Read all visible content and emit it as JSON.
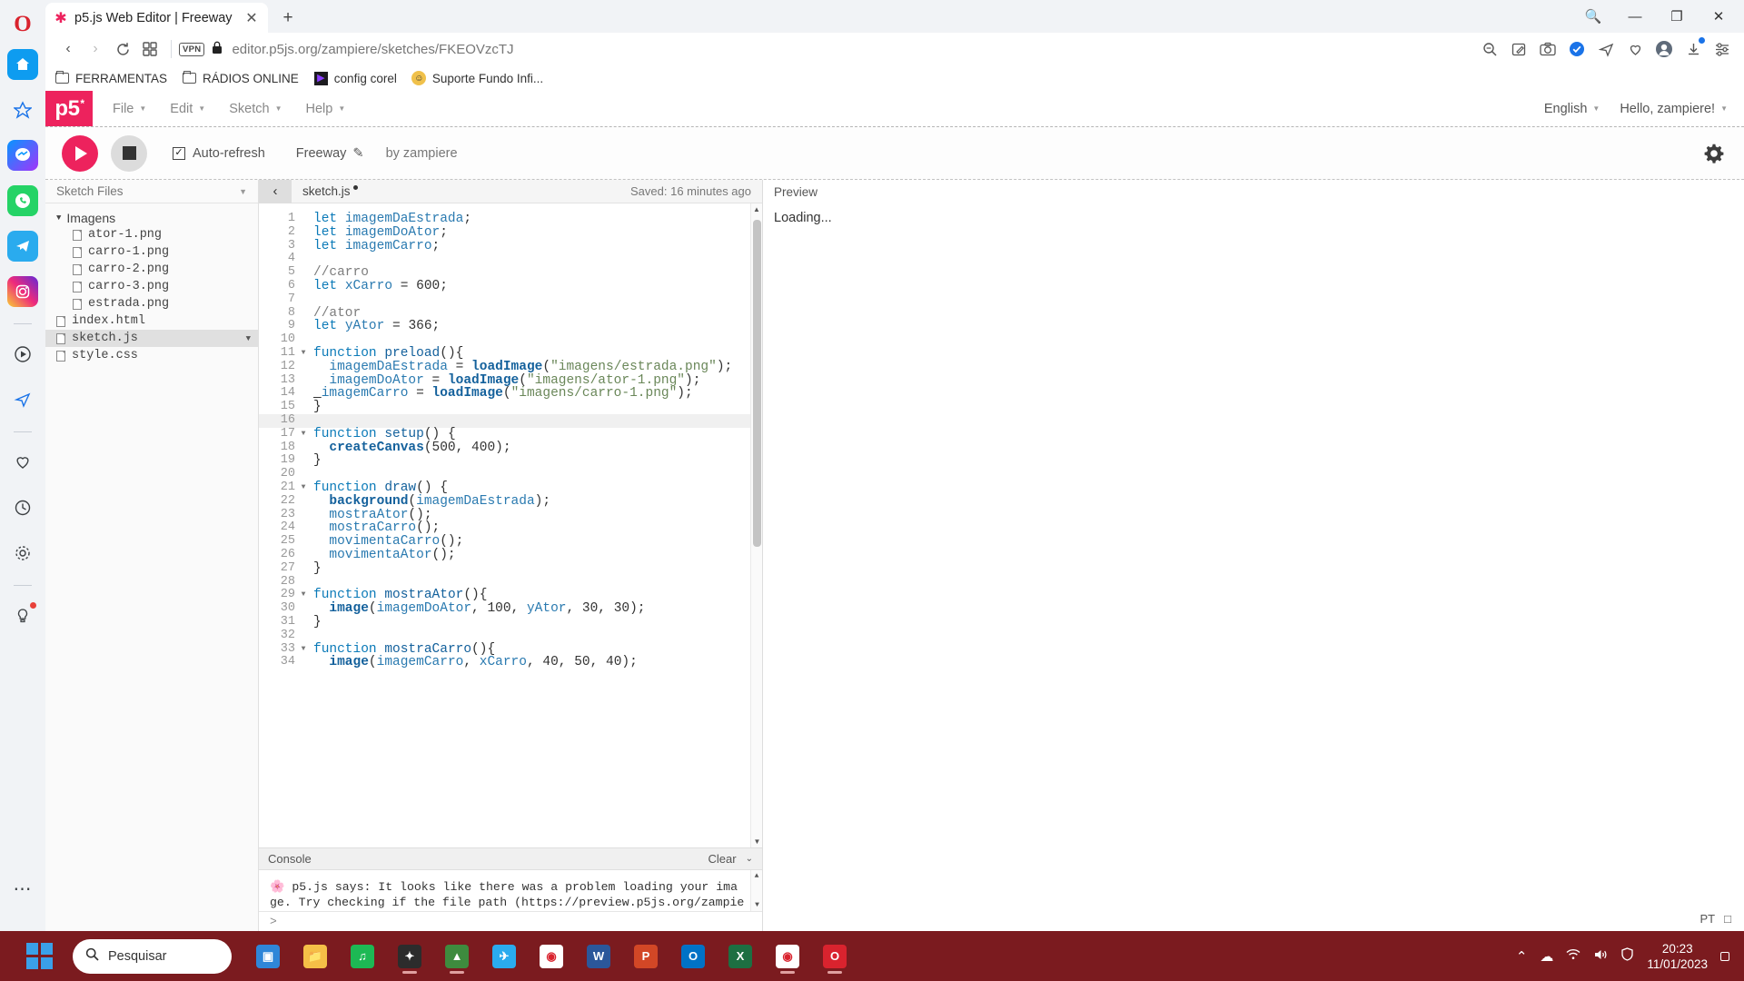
{
  "browser": {
    "name": "opera",
    "tab": {
      "title": "p5.js Web Editor | Freeway",
      "favicon": "p5-asterisk-icon",
      "close": "✕"
    },
    "newtab": "+",
    "nav": {
      "back": "‹",
      "forward": "›",
      "reload": "↻",
      "tabgrid": "∷",
      "vpn": "VPN",
      "lock": "🔒",
      "url_prefix": "editor.",
      "url_domain": "p5js.org",
      "url_path": "/zampiere/sketches/FKEOVzcTJ",
      "url_full": "editor.p5js.org/zampiere/sketches/FKEOVzcTJ"
    },
    "window_controls": {
      "minimize": "—",
      "maximize": "❐",
      "close": "✕",
      "search": "🔍"
    },
    "bookmarks": [
      {
        "label": "FERRAMENTAS",
        "icon": "folder-icon"
      },
      {
        "label": "RÁDIOS ONLINE",
        "icon": "folder-icon"
      },
      {
        "label": "config corel",
        "icon": "corel-icon"
      },
      {
        "label": "Suporte Fundo Infi...",
        "icon": "support-icon"
      }
    ]
  },
  "p5": {
    "logo": "p5",
    "logo_star": "*",
    "menu": [
      {
        "label": "File"
      },
      {
        "label": "Edit"
      },
      {
        "label": "Sketch"
      },
      {
        "label": "Help"
      }
    ],
    "language": "English",
    "account": "Hello, zampiere!",
    "toolbar": {
      "play": "play-icon",
      "stop": "stop-icon",
      "autorefresh_label": "Auto-refresh",
      "autorefresh_checked": true,
      "check_glyph": "✓",
      "sketch_name": "Freeway",
      "rename_icon": "✎",
      "byline": "by zampiere",
      "settings_icon": "⚙"
    },
    "files": {
      "panel_title": "Sketch Files",
      "tree": [
        {
          "label": "Imagens",
          "type": "folder",
          "expanded": true,
          "depth": 0
        },
        {
          "label": "ator-1.png",
          "type": "file",
          "depth": 1
        },
        {
          "label": "carro-1.png",
          "type": "file",
          "depth": 1
        },
        {
          "label": "carro-2.png",
          "type": "file",
          "depth": 1
        },
        {
          "label": "carro-3.png",
          "type": "file",
          "depth": 1
        },
        {
          "label": "estrada.png",
          "type": "file",
          "depth": 1
        },
        {
          "label": "index.html",
          "type": "file",
          "depth": 0
        },
        {
          "label": "sketch.js",
          "type": "file",
          "depth": 0,
          "selected": true
        },
        {
          "label": "style.css",
          "type": "file",
          "depth": 0
        }
      ]
    },
    "editor": {
      "collapse_icon": "‹",
      "tab_name": "sketch.js",
      "unsaved_dot": true,
      "saved_status": "Saved: 16 minutes ago",
      "code_lines": [
        {
          "n": 1,
          "segs": [
            [
              "kw",
              "let "
            ],
            [
              "var",
              "imagemDaEstrada"
            ],
            [
              "pln",
              ";"
            ]
          ]
        },
        {
          "n": 2,
          "segs": [
            [
              "kw",
              "let "
            ],
            [
              "var",
              "imagemDoAtor"
            ],
            [
              "pln",
              ";"
            ]
          ]
        },
        {
          "n": 3,
          "segs": [
            [
              "kw",
              "let "
            ],
            [
              "var",
              "imagemCarro"
            ],
            [
              "pln",
              ";"
            ]
          ]
        },
        {
          "n": 4,
          "segs": []
        },
        {
          "n": 5,
          "segs": [
            [
              "cm",
              "//carro"
            ]
          ]
        },
        {
          "n": 6,
          "segs": [
            [
              "kw",
              "let "
            ],
            [
              "var",
              "xCarro"
            ],
            [
              "pln",
              " = "
            ],
            [
              "num",
              "600"
            ],
            [
              "pln",
              ";"
            ]
          ]
        },
        {
          "n": 7,
          "segs": []
        },
        {
          "n": 8,
          "segs": [
            [
              "cm",
              "//ator"
            ]
          ]
        },
        {
          "n": 9,
          "segs": [
            [
              "kw",
              "let "
            ],
            [
              "var",
              "yAtor"
            ],
            [
              "pln",
              " = "
            ],
            [
              "num",
              "366"
            ],
            [
              "pln",
              ";"
            ]
          ]
        },
        {
          "n": 10,
          "segs": []
        },
        {
          "n": 11,
          "fold": true,
          "segs": [
            [
              "kw",
              "function "
            ],
            [
              "def",
              "preload"
            ],
            [
              "pln",
              "(){"
            ]
          ]
        },
        {
          "n": 12,
          "segs": [
            [
              "pln",
              "  "
            ],
            [
              "var",
              "imagemDaEstrada"
            ],
            [
              "pln",
              " = "
            ],
            [
              "fnb",
              "loadImage"
            ],
            [
              "pln",
              "("
            ],
            [
              "str",
              "\"imagens/estrada.png\""
            ],
            [
              "pln",
              ");"
            ]
          ]
        },
        {
          "n": 13,
          "segs": [
            [
              "pln",
              "  "
            ],
            [
              "var",
              "imagemDoAtor"
            ],
            [
              "pln",
              " = "
            ],
            [
              "fnb",
              "loadImage"
            ],
            [
              "pln",
              "("
            ],
            [
              "str",
              "\"imagens/ator-1.png\""
            ],
            [
              "pln",
              ");"
            ]
          ]
        },
        {
          "n": 14,
          "segs": [
            [
              "und",
              " "
            ],
            [
              "var",
              "imagemCarro"
            ],
            [
              "pln",
              " = "
            ],
            [
              "fnb",
              "loadImage"
            ],
            [
              "pln",
              "("
            ],
            [
              "str",
              "\"imagens/carro-1.png\""
            ],
            [
              "pln",
              ");"
            ]
          ]
        },
        {
          "n": 15,
          "segs": [
            [
              "pln",
              "}"
            ]
          ]
        },
        {
          "n": 16,
          "hl": true,
          "segs": []
        },
        {
          "n": 17,
          "fold": true,
          "segs": [
            [
              "kw",
              "function "
            ],
            [
              "def",
              "setup"
            ],
            [
              "pln",
              "() {"
            ]
          ]
        },
        {
          "n": 18,
          "segs": [
            [
              "pln",
              "  "
            ],
            [
              "fnb",
              "createCanvas"
            ],
            [
              "pln",
              "("
            ],
            [
              "num",
              "500"
            ],
            [
              "pln",
              ", "
            ],
            [
              "num",
              "400"
            ],
            [
              "pln",
              ");"
            ]
          ]
        },
        {
          "n": 19,
          "segs": [
            [
              "pln",
              "}"
            ]
          ]
        },
        {
          "n": 20,
          "segs": []
        },
        {
          "n": 21,
          "fold": true,
          "segs": [
            [
              "kw",
              "function "
            ],
            [
              "def",
              "draw"
            ],
            [
              "pln",
              "() {"
            ]
          ]
        },
        {
          "n": 22,
          "segs": [
            [
              "pln",
              "  "
            ],
            [
              "fnb",
              "background"
            ],
            [
              "pln",
              "("
            ],
            [
              "var",
              "imagemDaEstrada"
            ],
            [
              "pln",
              ");"
            ]
          ]
        },
        {
          "n": 23,
          "segs": [
            [
              "pln",
              "  "
            ],
            [
              "var",
              "mostraAtor"
            ],
            [
              "pln",
              "();"
            ]
          ]
        },
        {
          "n": 24,
          "segs": [
            [
              "pln",
              "  "
            ],
            [
              "var",
              "mostraCarro"
            ],
            [
              "pln",
              "();"
            ]
          ]
        },
        {
          "n": 25,
          "segs": [
            [
              "pln",
              "  "
            ],
            [
              "var",
              "movimentaCarro"
            ],
            [
              "pln",
              "();"
            ]
          ]
        },
        {
          "n": 26,
          "segs": [
            [
              "pln",
              "  "
            ],
            [
              "var",
              "movimentaAtor"
            ],
            [
              "pln",
              "();"
            ]
          ]
        },
        {
          "n": 27,
          "segs": [
            [
              "pln",
              "}"
            ]
          ]
        },
        {
          "n": 28,
          "segs": []
        },
        {
          "n": 29,
          "fold": true,
          "segs": [
            [
              "kw",
              "function "
            ],
            [
              "def",
              "mostraAtor"
            ],
            [
              "pln",
              "(){"
            ]
          ]
        },
        {
          "n": 30,
          "segs": [
            [
              "pln",
              "  "
            ],
            [
              "fnb",
              "image"
            ],
            [
              "pln",
              "("
            ],
            [
              "var",
              "imagemDoAtor"
            ],
            [
              "pln",
              ", "
            ],
            [
              "num",
              "100"
            ],
            [
              "pln",
              ", "
            ],
            [
              "var",
              "yAtor"
            ],
            [
              "pln",
              ", "
            ],
            [
              "num",
              "30"
            ],
            [
              "pln",
              ", "
            ],
            [
              "num",
              "30"
            ],
            [
              "pln",
              ");"
            ]
          ]
        },
        {
          "n": 31,
          "segs": [
            [
              "pln",
              "}"
            ]
          ]
        },
        {
          "n": 32,
          "segs": []
        },
        {
          "n": 33,
          "fold": true,
          "segs": [
            [
              "kw",
              "function "
            ],
            [
              "def",
              "mostraCarro"
            ],
            [
              "pln",
              "(){"
            ]
          ]
        },
        {
          "n": 34,
          "segs": [
            [
              "pln",
              "  "
            ],
            [
              "fnb",
              "image"
            ],
            [
              "pln",
              "("
            ],
            [
              "var",
              "imagemCarro"
            ],
            [
              "pln",
              ", "
            ],
            [
              "var",
              "xCarro"
            ],
            [
              "pln",
              ", "
            ],
            [
              "num",
              "40"
            ],
            [
              "pln",
              ", "
            ],
            [
              "num",
              "50"
            ],
            [
              "pln",
              ", "
            ],
            [
              "num",
              "40"
            ],
            [
              "pln",
              ");"
            ]
          ]
        }
      ]
    },
    "console": {
      "title": "Console",
      "clear_label": "Clear",
      "collapse_caret": "⌄",
      "message_icon": "🌸",
      "message": "p5.js says: It looks like there was a problem loading your ima\nge. Try checking if the file path (https://preview.p5js.org/zampie",
      "prompt": ">"
    },
    "preview": {
      "title": "Preview",
      "status": "Loading..."
    }
  },
  "taskbar": {
    "search_placeholder": "Pesquisar",
    "search_icon": "🔍",
    "apps": [
      {
        "name": "taskview",
        "label": "▣",
        "color": "#2f86d8",
        "running": false
      },
      {
        "name": "explorer",
        "label": "📁",
        "color": "#f5bf47",
        "running": false
      },
      {
        "name": "spotify",
        "label": "♫",
        "color": "#1db954",
        "running": false
      },
      {
        "name": "app-dark",
        "label": "✦",
        "color": "#2c2c2c",
        "running": true
      },
      {
        "name": "app-green",
        "label": "▲",
        "color": "#3e8b3e",
        "running": true
      },
      {
        "name": "telegram",
        "label": "✈",
        "color": "#2aabee",
        "running": false
      },
      {
        "name": "chrome",
        "label": "◉",
        "color": "#ffffff",
        "running": false
      },
      {
        "name": "word",
        "label": "W",
        "color": "#2b579a",
        "running": false
      },
      {
        "name": "powerpoint",
        "label": "P",
        "color": "#d24726",
        "running": false
      },
      {
        "name": "outlook",
        "label": "O",
        "color": "#0072c6",
        "running": false
      },
      {
        "name": "excel",
        "label": "X",
        "color": "#1d6f42",
        "running": false
      },
      {
        "name": "chrome2",
        "label": "◉",
        "color": "#ffffff",
        "running": true
      },
      {
        "name": "opera",
        "label": "O",
        "color": "#d9232e",
        "running": true
      }
    ],
    "tray": {
      "chevron": "⌃",
      "cloud": "☁",
      "wifi": "◠",
      "volume": "🔊",
      "shield": "🛡",
      "lang": "PT"
    },
    "clock": {
      "time": "20:23",
      "date": "11/01/2023"
    }
  },
  "colors": {
    "p5_pink": "#ed225d",
    "opera_red": "#d9232e",
    "taskbar": "#7b1b1f",
    "chrome_bg": "#f1f3f6"
  }
}
